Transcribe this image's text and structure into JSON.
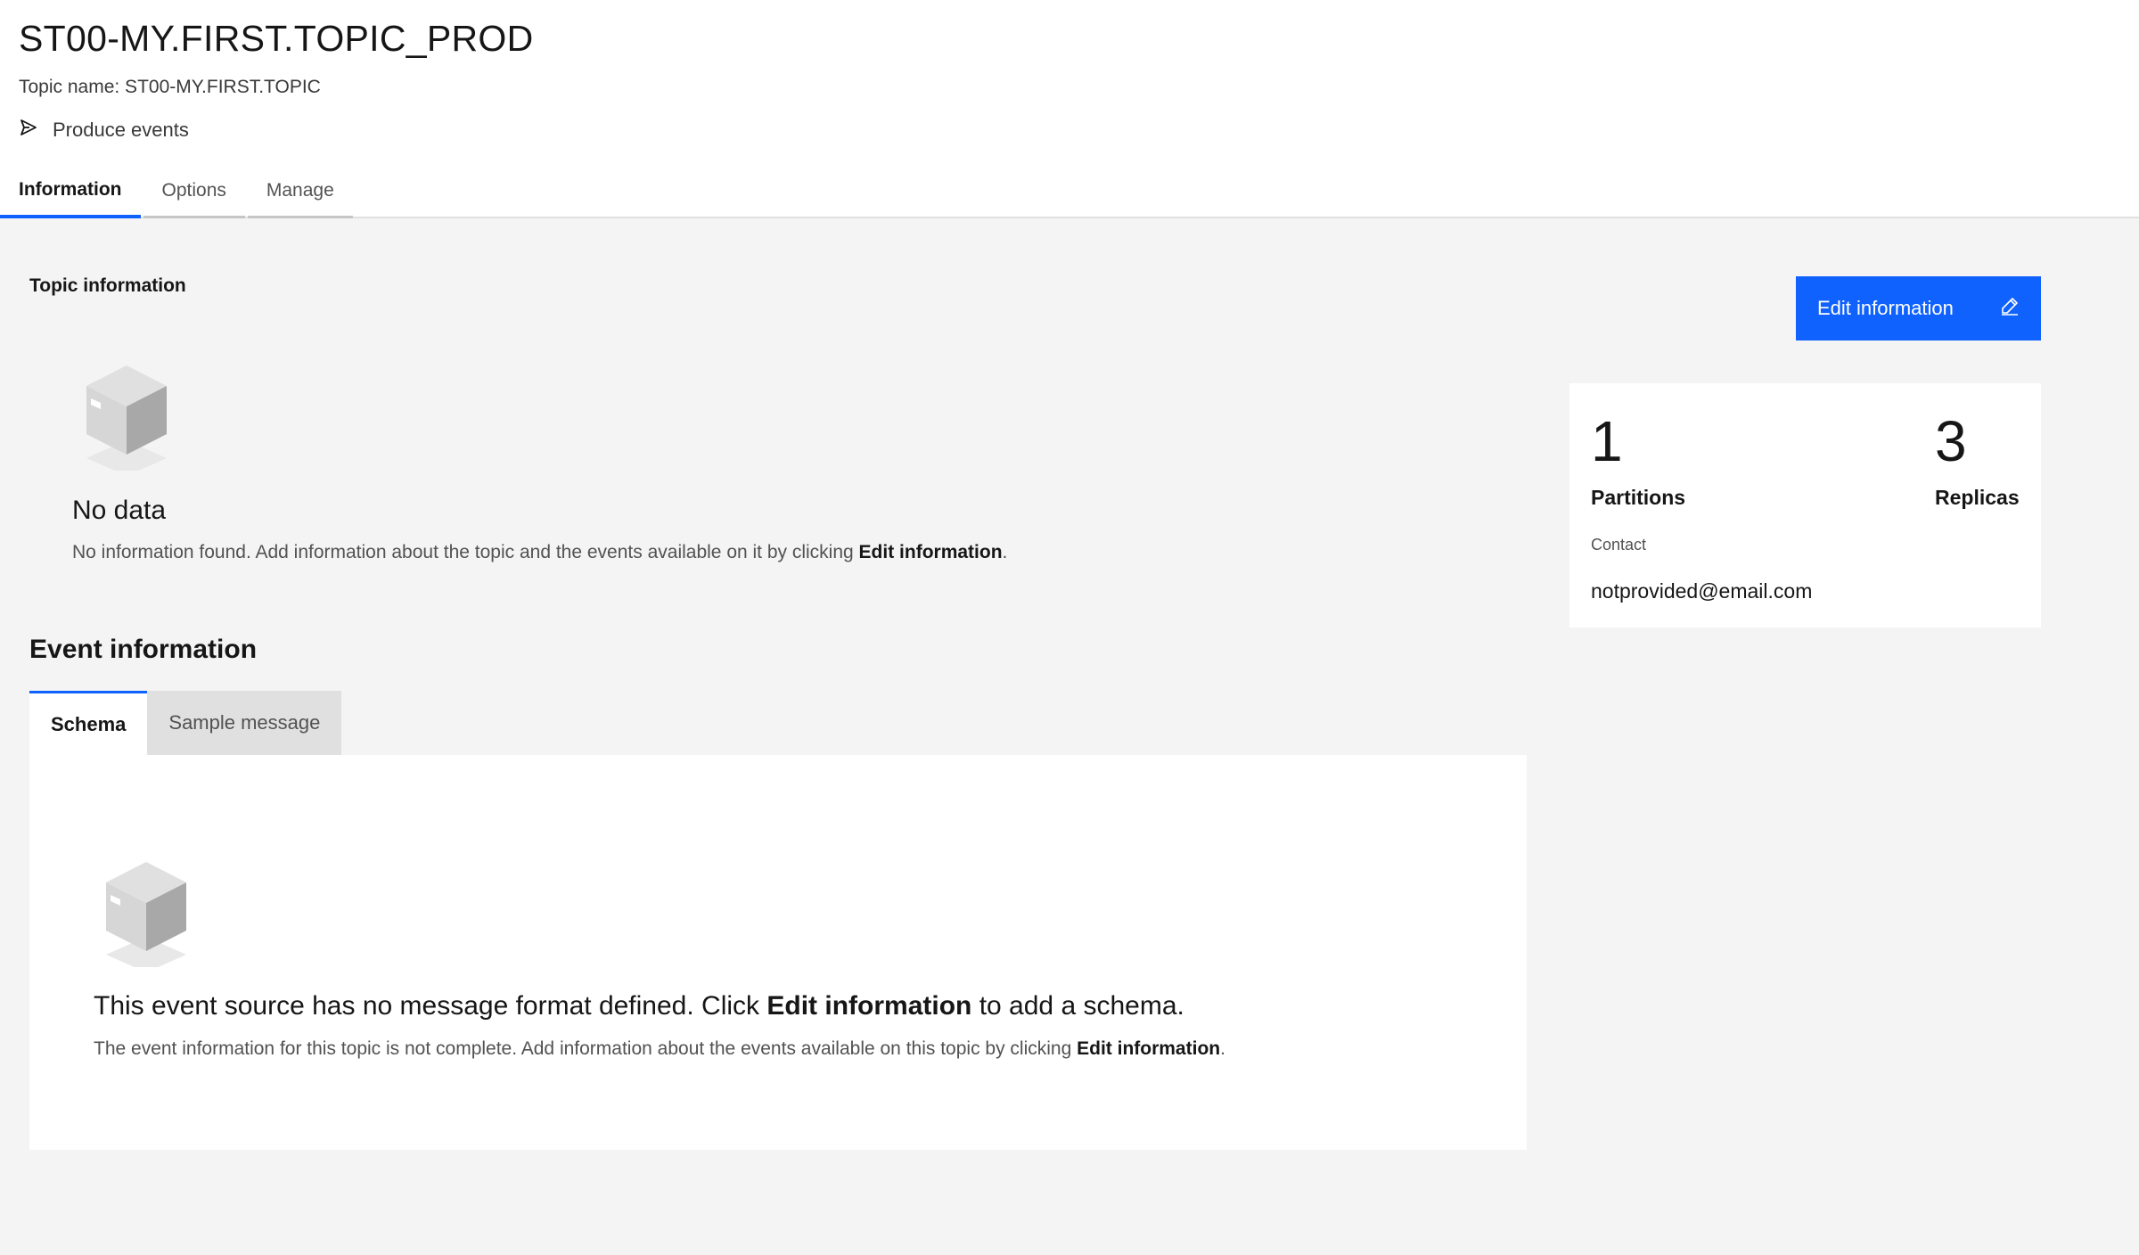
{
  "header": {
    "title": "ST00-MY.FIRST.TOPIC_PROD",
    "topic_name": "Topic name: ST00-MY.FIRST.TOPIC",
    "produce_label": "Produce events"
  },
  "tabs": [
    {
      "label": "Information",
      "active": true
    },
    {
      "label": "Options",
      "active": false
    },
    {
      "label": "Manage",
      "active": false
    }
  ],
  "topic_info": {
    "section_title": "Topic information",
    "edit_button_label": "Edit information",
    "empty_title": "No data",
    "empty_desc_prefix": "No information found. Add information about the topic and the events available on it by clicking ",
    "empty_desc_link": "Edit information",
    "empty_desc_suffix": "."
  },
  "stats": {
    "partitions_value": "1",
    "partitions_label": "Partitions",
    "replicas_value": "3",
    "replicas_label": "Replicas",
    "contact_label": "Contact",
    "contact_value": "notprovided@email.com"
  },
  "event_info": {
    "title": "Event information",
    "tabs": [
      {
        "label": "Schema",
        "active": true
      },
      {
        "label": "Sample message",
        "active": false
      }
    ],
    "empty_title_prefix": "This event source has no message format defined. Click ",
    "empty_title_link": "Edit information",
    "empty_title_suffix": " to add a schema.",
    "empty_desc_prefix": "The event information for this topic is not complete. Add information about the events available on this topic by clicking ",
    "empty_desc_link": "Edit information",
    "empty_desc_suffix": "."
  },
  "colors": {
    "accent": "#0f62fe",
    "background": "#f4f4f4",
    "surface": "#ffffff"
  },
  "icons": {
    "produce": "send-icon",
    "edit": "edit-pencil-icon",
    "empty": "empty-box-icon"
  }
}
